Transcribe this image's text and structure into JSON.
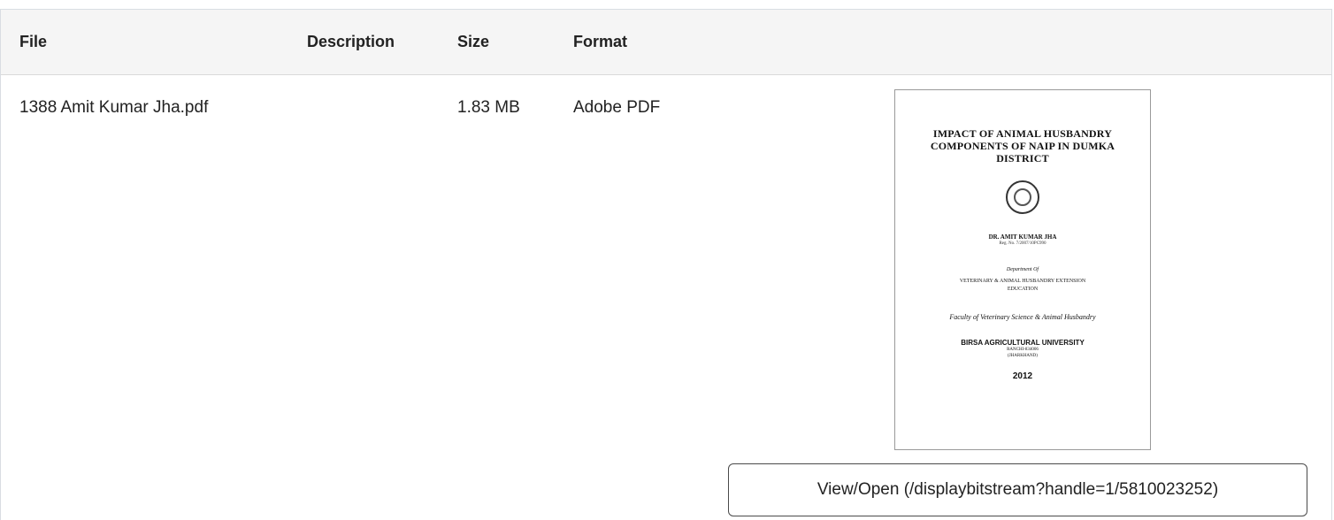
{
  "table": {
    "headers": {
      "file": "File",
      "description": "Description",
      "size": "Size",
      "format": "Format"
    },
    "rows": [
      {
        "file": "1388 Amit Kumar Jha.pdf",
        "description": "",
        "size": "1.83 MB",
        "format": "Adobe PDF",
        "thumbnail": {
          "title_lines": [
            "IMPACT OF ANIMAL HUSBANDRY",
            "COMPONENTS OF NAIP IN DUMKA",
            "DISTRICT"
          ],
          "author": "DR. AMIT KUMAR JHA",
          "registration": "Reg. No. 7/2007/10PC990",
          "department_label": "Department Of",
          "department_lines": [
            "VETERINARY & ANIMAL HUSBANDRY EXTENSION",
            "EDUCATION"
          ],
          "faculty": "Faculty of Veterinary Science & Animal Husbandry",
          "university": "BIRSA AGRICULTURAL UNIVERSITY",
          "location_lines": [
            "RANCHI-834006",
            "(JHARKHAND)"
          ],
          "year": "2012"
        },
        "view_button": "View/Open (/displaybitstream?handle=1/5810023252)"
      }
    ]
  }
}
